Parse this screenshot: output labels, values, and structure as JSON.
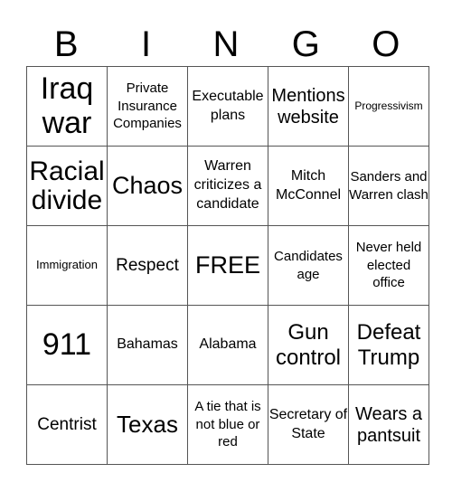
{
  "header": [
    "B",
    "I",
    "N",
    "G",
    "O"
  ],
  "rows": [
    [
      "Iraq war",
      "Private Insurance Companies",
      "Executable plans",
      "Mentions website",
      "Progressivism"
    ],
    [
      "Racial divide",
      "Chaos",
      "Warren criticizes a candidate",
      "Mitch McConnel",
      "Sanders and Warren clash"
    ],
    [
      "Immigration",
      "Respect",
      "FREE",
      "Candidates age",
      "Never held elected office"
    ],
    [
      "911",
      "Bahamas",
      "Alabama",
      "Gun control",
      "Defeat Trump"
    ],
    [
      "Centrist",
      "Texas",
      "A tie that is not blue or red",
      "Secretary of State",
      "Wears a pantsuit"
    ]
  ]
}
